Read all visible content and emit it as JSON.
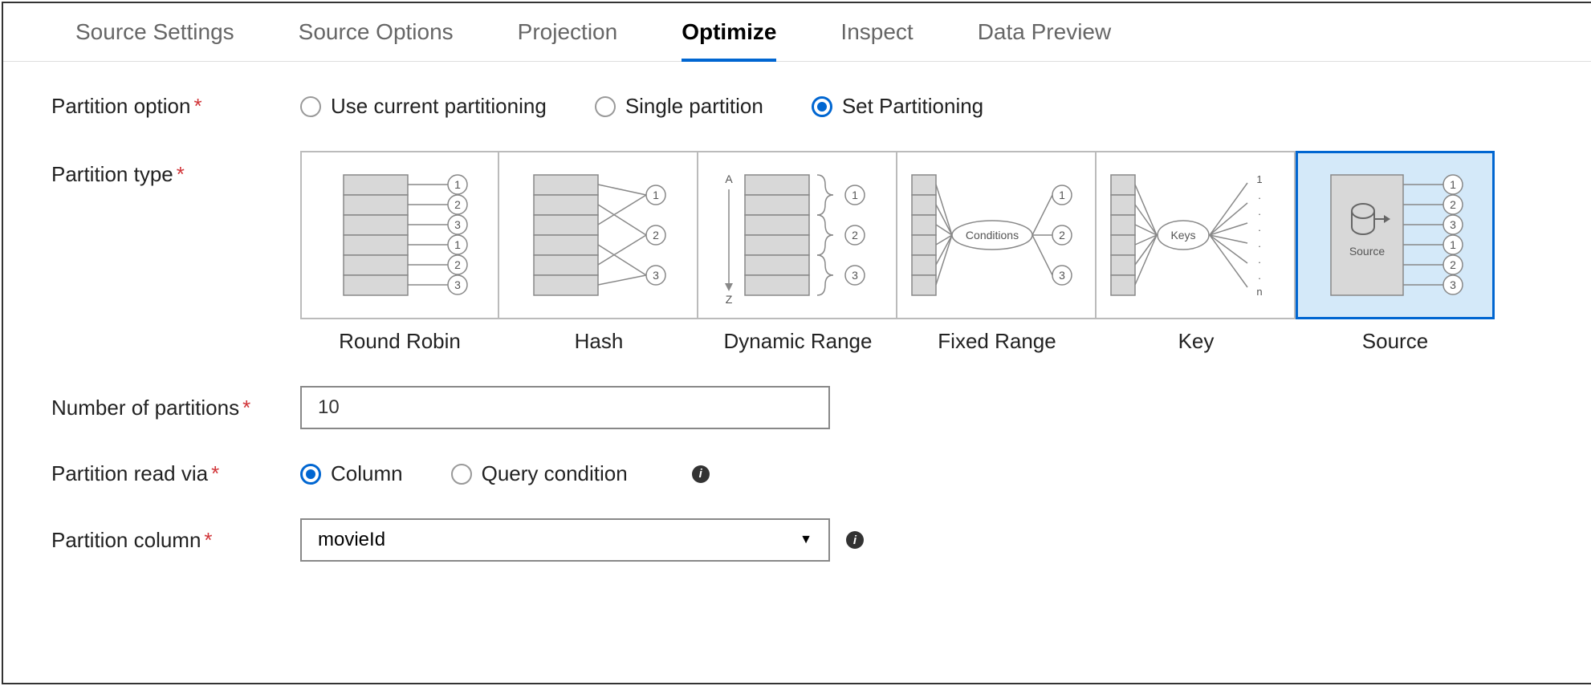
{
  "tabs": [
    {
      "label": "Source Settings",
      "active": false
    },
    {
      "label": "Source Options",
      "active": false
    },
    {
      "label": "Projection",
      "active": false
    },
    {
      "label": "Optimize",
      "active": true
    },
    {
      "label": "Inspect",
      "active": false
    },
    {
      "label": "Data Preview",
      "active": false
    }
  ],
  "partition_option": {
    "label": "Partition option",
    "options": [
      {
        "label": "Use current partitioning",
        "selected": false
      },
      {
        "label": "Single partition",
        "selected": false
      },
      {
        "label": "Set Partitioning",
        "selected": true
      }
    ]
  },
  "partition_type": {
    "label": "Partition type",
    "cards": [
      {
        "label": "Round Robin",
        "selected": false
      },
      {
        "label": "Hash",
        "selected": false
      },
      {
        "label": "Dynamic Range",
        "selected": false
      },
      {
        "label": "Fixed Range",
        "selected": false
      },
      {
        "label": "Key",
        "selected": false
      },
      {
        "label": "Source",
        "selected": true
      }
    ]
  },
  "num_partitions": {
    "label": "Number of partitions",
    "value": "10"
  },
  "partition_read_via": {
    "label": "Partition read via",
    "options": [
      {
        "label": "Column",
        "selected": true
      },
      {
        "label": "Query condition",
        "selected": false
      }
    ]
  },
  "partition_column": {
    "label": "Partition column",
    "value": "movieId"
  },
  "diagram": {
    "round_robin_nums": [
      "1",
      "2",
      "3",
      "1",
      "2",
      "3"
    ],
    "hash_nums": [
      "1",
      "2",
      "3"
    ],
    "dyn_range_nums": [
      "1",
      "2",
      "3"
    ],
    "dyn_range_az": {
      "a": "A",
      "z": "Z"
    },
    "fixed_range_label": "Conditions",
    "fixed_range_nums": [
      "1",
      "2",
      "3"
    ],
    "key_label": "Keys",
    "key_seq": [
      "1",
      ".",
      ".",
      ".",
      ".",
      ".",
      ".",
      "n"
    ],
    "source_label": "Source",
    "source_nums": [
      "1",
      "2",
      "3",
      "1",
      "2",
      "3"
    ]
  }
}
